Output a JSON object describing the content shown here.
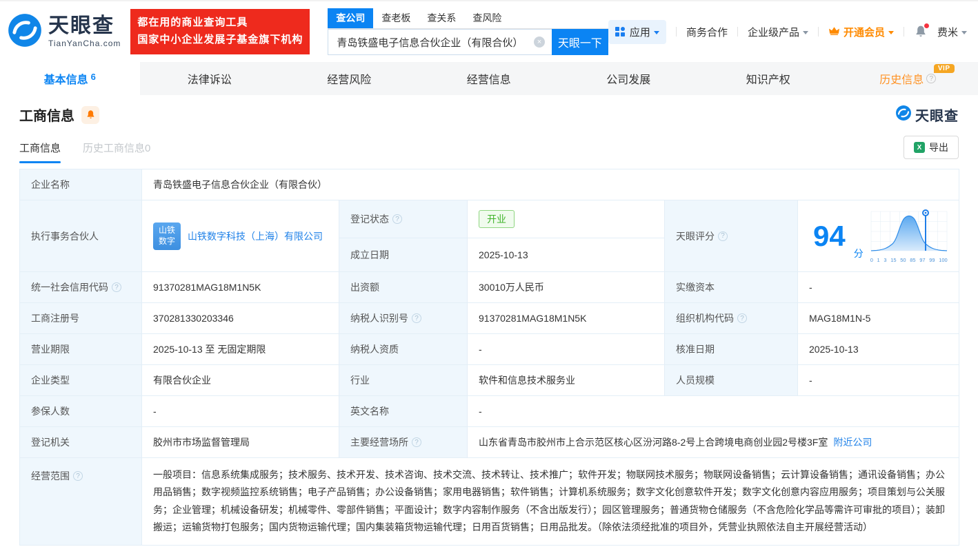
{
  "header": {
    "logo_title": "天眼查",
    "logo_sub": "TianYanCha.com",
    "slogan_line1": "都在用的商业查询工具",
    "slogan_line2": "国家中小企业发展子基金旗下机构",
    "search_tabs": [
      "查公司",
      "查老板",
      "查关系",
      "查风险"
    ],
    "search_value": "青岛铁盛电子信息合伙企业（有限合伙）",
    "search_button": "天眼一下",
    "nav": {
      "app": "应用",
      "cooperation": "商务合作",
      "enterprise": "企业级产品",
      "vip": "开通会员",
      "user": "费米"
    }
  },
  "tabs": [
    {
      "label": "基本信息",
      "count": "6"
    },
    {
      "label": "法律诉讼"
    },
    {
      "label": "经营风险"
    },
    {
      "label": "经营信息"
    },
    {
      "label": "公司发展"
    },
    {
      "label": "知识产权"
    },
    {
      "label": "历史信息",
      "vip_badge": "VIP"
    }
  ],
  "section": {
    "title": "工商信息",
    "subtab_current": "工商信息",
    "subtab_history": "历史工商信息0",
    "export_label": "导出",
    "corner_logo": "天眼查"
  },
  "company": {
    "name_label": "企业名称",
    "name": "青岛铁盛电子信息合伙企业（有限合伙）",
    "partner_label": "执行事务合伙人",
    "partner_avatar_line1": "山铁",
    "partner_avatar_line2": "数字",
    "partner_name": "山铁数字科技（上海）有限公司",
    "reg_status_label": "登记状态",
    "reg_status": "开业",
    "establish_label": "成立日期",
    "establish_date": "2025-10-13",
    "score_label": "天眼评分",
    "score_value": "94",
    "score_unit": "分",
    "uscc_label": "统一社会信用代码",
    "uscc": "91370281MAG18M1N5K",
    "capital_label": "出资额",
    "capital": "30010万人民币",
    "paid_capital_label": "实缴资本",
    "paid_capital": "-",
    "reg_no_label": "工商注册号",
    "reg_no": "370281330203346",
    "taxpayer_id_label": "纳税人识别号",
    "taxpayer_id": "91370281MAG18M1N5K",
    "org_code_label": "组织机构代码",
    "org_code": "MAG18M1N-5",
    "term_label": "营业期限",
    "term": "2025-10-13 至 无固定期限",
    "taxpayer_quality_label": "纳税人资质",
    "taxpayer_quality": "-",
    "approval_label": "核准日期",
    "approval_date": "2025-10-13",
    "type_label": "企业类型",
    "type": "有限合伙企业",
    "industry_label": "行业",
    "industry": "软件和信息技术服务业",
    "staff_label": "人员规模",
    "staff": "-",
    "insured_label": "参保人数",
    "insured": "-",
    "en_name_label": "英文名称",
    "en_name": "-",
    "authority_label": "登记机关",
    "authority": "胶州市市场监督管理局",
    "address_label": "主要经营场所",
    "address": "山东省青岛市胶州市上合示范区核心区汾河路8-2号上合跨境电商创业园2号楼3F室",
    "nearby_link": "附近公司",
    "scope_label": "经营范围",
    "scope": "一般项目：信息系统集成服务；技术服务、技术开发、技术咨询、技术交流、技术转让、技术推广；软件开发；物联网技术服务；物联网设备销售；云计算设备销售；通讯设备销售；办公用品销售；数字视频监控系统销售；电子产品销售；办公设备销售；家用电器销售；软件销售；计算机系统服务；数字文化创意软件开发；数字文化创意内容应用服务；项目策划与公关服务；企业管理；机械设备研发；机械零件、零部件销售；平面设计；数字内容制作服务（不含出版发行）；园区管理服务；普通货物仓储服务（不含危险化学品等需许可审批的项目）；装卸搬运；运输货物打包服务；国内货物运输代理；国内集装箱货物运输代理；日用百货销售；日用品批发。（除依法须经批准的项目外，凭营业执照依法自主开展经营活动）"
  },
  "score_chart": {
    "type": "area",
    "ticks": [
      "0",
      "1",
      "3",
      "15",
      "50",
      "85",
      "97",
      "99",
      "100"
    ],
    "marker_value": "94",
    "accent_color": "#1f7ee8"
  },
  "colors": {
    "primary_blue": "#0b84f3",
    "link_blue": "#1f81e8",
    "brand_red": "#ee2a1d",
    "vip_orange": "#ff8a00",
    "status_green": "#3fb32a",
    "label_bg": "#eff7fd"
  }
}
